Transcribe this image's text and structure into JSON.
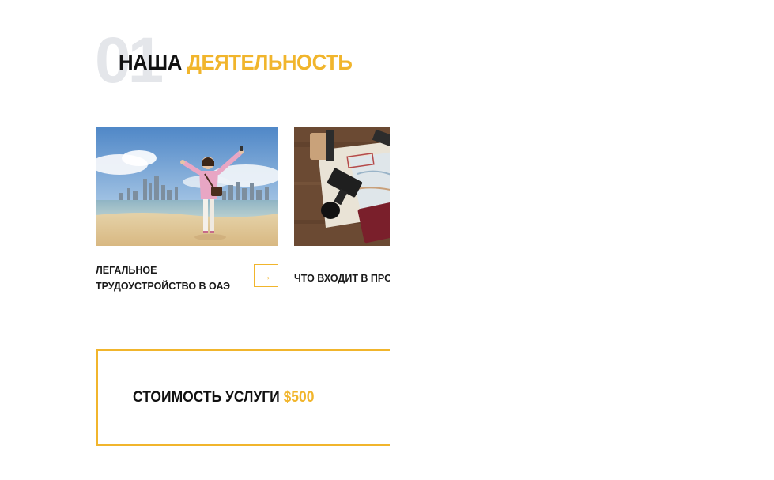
{
  "section": {
    "number": "01",
    "title_part1": "НАША",
    "title_part2": "ДЕЯТЕЛЬНОСТЬ"
  },
  "cards": [
    {
      "title": "ЛЕГАЛЬНОЕ ТРУДОУСТРОЙСТВО В ОАЭ",
      "arrow_icon": "→"
    },
    {
      "title": "ЧТО ВХОДИТ В ПРОЦЕДУРУ"
    }
  ],
  "price": {
    "label": "СТОИМОСТЬ УСЛУГИ",
    "value": "$500"
  },
  "colors": {
    "accent": "#f1b52c",
    "text": "#111111",
    "number_watermark": "#e4e6ea"
  }
}
